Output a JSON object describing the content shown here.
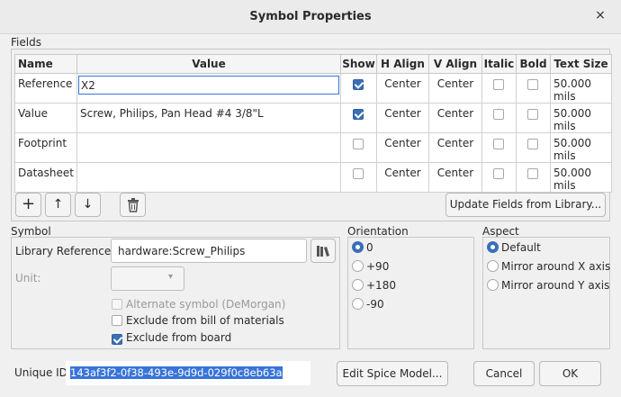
{
  "window": {
    "title": "Symbol Properties",
    "close_glyph": "×"
  },
  "fields": {
    "group_label": "Fields",
    "columns": [
      "Name",
      "Value",
      "Show",
      "H Align",
      "V Align",
      "Italic",
      "Bold",
      "Text Size"
    ],
    "rows": [
      {
        "name": "Reference",
        "value": "X2",
        "show": true,
        "halign": "Center",
        "valign": "Center",
        "italic": false,
        "bold": false,
        "size": "50.000 mils"
      },
      {
        "name": "Value",
        "value": "Screw, Philips, Pan Head #4 3/8\"L",
        "show": true,
        "halign": "Center",
        "valign": "Center",
        "italic": false,
        "bold": false,
        "size": "50.000 mils"
      },
      {
        "name": "Footprint",
        "value": "",
        "show": false,
        "halign": "Center",
        "valign": "Center",
        "italic": false,
        "bold": false,
        "size": "50.000 mils"
      },
      {
        "name": "Datasheet",
        "value": "",
        "show": false,
        "halign": "Center",
        "valign": "Center",
        "italic": false,
        "bold": false,
        "size": "50.000 mils"
      }
    ],
    "buttons": {
      "add": "+",
      "up": "↑",
      "down": "↓",
      "delete_icon": "trash-icon"
    },
    "update_button": "Update Fields from Library..."
  },
  "symbol": {
    "group_label": "Symbol",
    "lib_ref_label": "Library Reference:",
    "lib_ref_value": "hardware:Screw_Philips",
    "unit_label": "Unit:",
    "unit_value": "",
    "alternate_label": "Alternate symbol (DeMorgan)",
    "alternate_checked": false,
    "exclude_bom_label": "Exclude from bill of materials",
    "exclude_bom_checked": false,
    "exclude_board_label": "Exclude from board",
    "exclude_board_checked": true
  },
  "orientation": {
    "group_label": "Orientation",
    "options": [
      "0",
      "+90",
      "+180",
      "-90"
    ],
    "selected": "0"
  },
  "aspect": {
    "group_label": "Aspect",
    "options": [
      "Default",
      "Mirror around X axis",
      "Mirror around Y axis"
    ],
    "selected": "Default"
  },
  "footer": {
    "unique_id_label": "Unique ID:",
    "unique_id_value": "143af3f2-0f38-493e-9d9d-029f0c8eb63a",
    "spice_button": "Edit Spice Model...",
    "cancel_button": "Cancel",
    "ok_button": "OK"
  },
  "colors": {
    "accent": "#3b6fb6",
    "selection": "#3874d8"
  }
}
